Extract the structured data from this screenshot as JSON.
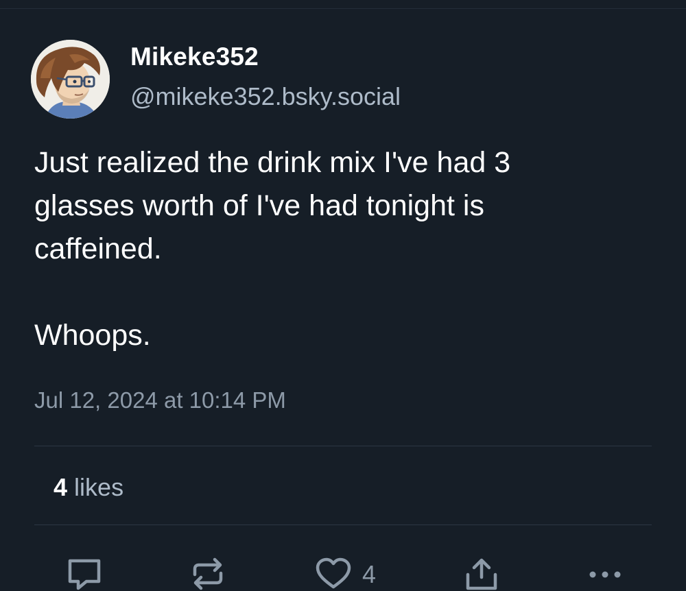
{
  "post": {
    "author": {
      "display_name": "Mikeke352",
      "handle": "@mikeke352.bsky.social",
      "avatar": "avatar-cartoon-portrait"
    },
    "text": "Just realized the drink mix I've had 3\nglasses worth of I've had tonight is\ncaffeined.\n\nWhoops.",
    "timestamp": "Jul 12, 2024 at 10:14 PM",
    "stats": {
      "likes_count": "4",
      "likes_label": "likes"
    },
    "actions": {
      "reply_icon": "reply-bubble-icon",
      "repost_icon": "repost-icon",
      "like_icon": "heart-icon",
      "like_count": "4",
      "share_icon": "share-icon",
      "more_icon": "more-dots-icon"
    }
  },
  "colors": {
    "background": "#161e27",
    "text": "#ffffff",
    "muted": "#8d9aa8",
    "divider": "#2c3744"
  }
}
